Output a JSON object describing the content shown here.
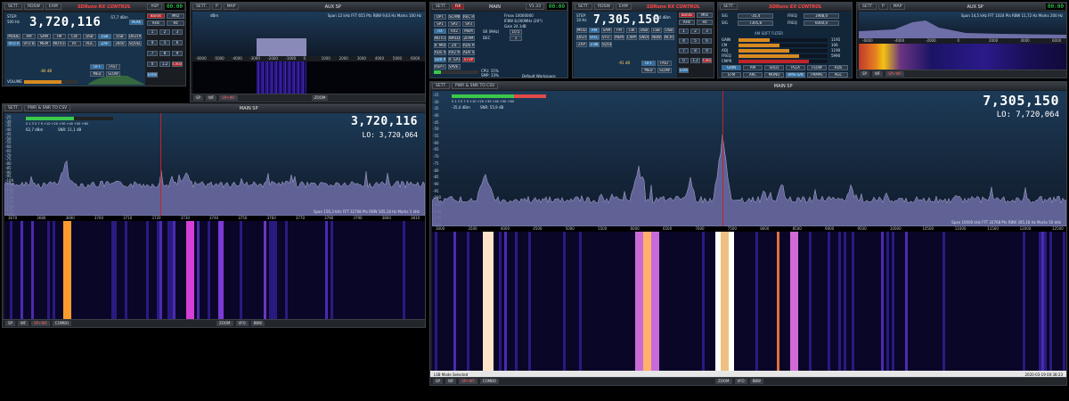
{
  "colors": {
    "accent": "#2c6fa6",
    "marker": "#c0242a",
    "spectrum_fill": "#6e6ea8",
    "segment_green": "#3cff6e"
  },
  "top_left_control": {
    "title": "SDRuno RX CONTROL",
    "clock": "00:00",
    "step_label": "STEP:",
    "step_value": "500 Hz",
    "freq": "3,720,116",
    "dbm": "-57,7 dBm",
    "buttons": [
      "MODE",
      "AM",
      "SAM",
      "FM",
      "CW",
      "DSB",
      "LSB",
      "USB",
      "DIGITAL",
      "VFO A",
      "VFO B",
      "MEM",
      "NOTCH",
      "RF",
      "AGC",
      "ZAP",
      "2850",
      "SQUELCH"
    ],
    "labels": [
      "VFO - CW",
      "FM MODE",
      "NB",
      "NBW",
      "WFM",
      "NFM",
      "MUTE",
      "RX",
      "VOLUME"
    ],
    "squelch_value": "-84 dB",
    "agc_buttons": [
      "OFF",
      "FAST",
      "MED",
      "SLOW"
    ],
    "keypad": [
      "1",
      "2",
      "3",
      "4",
      "5",
      "6",
      "7",
      "8",
      "9",
      "0",
      "1.2",
      "Clear",
      "Enter"
    ],
    "band_buttons": [
      "Bands",
      "Mhz",
      "KHz",
      "Hz"
    ],
    "titlebar_buttons": [
      "SETT.",
      "RDSW",
      "EXM",
      "ASP"
    ],
    "rx_tag": "RX",
    "mode_chip": "PEAK"
  },
  "top_aux_sp": {
    "title": "AUX SP",
    "titlebar_buttons": [
      "SETT.",
      "P",
      "MAP"
    ],
    "dbm_label": "dBm",
    "span_info": "Span 12 kHz  FFT 655 Pts  RBW 9,63 Hz  Marks 100 Hz",
    "ticks": [
      "-6000",
      "-5000",
      "-4000",
      "-3000",
      "-2000",
      "-1000",
      "0",
      "1000",
      "2000",
      "3000",
      "4000",
      "5000",
      "6000"
    ],
    "status_buttons": [
      "SP",
      "WF",
      "SP+WF",
      "ZOOM"
    ]
  },
  "main_window": {
    "title": "MAIN",
    "titlebar_buttons": [
      "SETT.",
      "RX",
      "V1.33"
    ],
    "buttons": [
      "OPT.",
      "SCANNER",
      "REC PANEL",
      "SP1",
      "SP2",
      "SP3",
      "RX",
      "RX2",
      "MEM",
      "NOTCHES",
      "WRLDM",
      "ZFAM",
      "IF MODE",
      "ZIF",
      "RDS PLAY",
      "RDS VRB",
      "RX2 MODE",
      "ADV VRB",
      "SDR PLAY",
      "IF GAIN",
      "STOP",
      "RSP-TT",
      "SAVE WS"
    ],
    "fmax_label": "Fmax",
    "fmax_value": "10000000",
    "ifbw_label": "IFBW",
    "ifbw_value": "8,000MHz (20*)",
    "gain_label": "Gain",
    "gain_value": "24.1dB",
    "sr_label": "SR (MHz)",
    "sr_value": "10.5",
    "dec_label": "DEC",
    "dec_value": "1",
    "cpu_label": "CPU",
    "cpu_value": "CPU: 15%",
    "smp_label": "SMP",
    "smp_value": "SMP: 33%",
    "workspace_label": "Default Workspace",
    "clock": "00:00"
  },
  "mid_control": {
    "title": "SDRuno RX CONTROL",
    "step_label": "STEP:",
    "step_value": "10 Hz",
    "freq": "7,305,150",
    "dbm": "-35,4 dBm",
    "clock": "00:00",
    "titlebar_buttons": [
      "SETT.",
      "RDSW",
      "EXM",
      "AUTO",
      "REYN1",
      "MCTR",
      "TCTR"
    ],
    "buttons": [
      "MODE",
      "AM",
      "SAM",
      "FM",
      "CW",
      "DSB",
      "LSB",
      "USB",
      "DIGITAL",
      "VFO A",
      "VFO B",
      "MEM",
      "CWPW",
      "SNOOP",
      "NBW",
      "NCRS",
      "ZAP",
      "2.8K",
      "SQUELCH"
    ],
    "agc_buttons": [
      "OFF",
      "FAST",
      "MED",
      "SLOW"
    ],
    "keypad": [
      "1",
      "2",
      "3",
      "4",
      "5",
      "6",
      "7",
      "8",
      "9",
      "0",
      "1.2",
      "Clear",
      "Enter"
    ],
    "band_buttons": [
      "Bands",
      "Mhz",
      "KHz",
      "Hz"
    ],
    "squelch_value": "-91 dB",
    "volume_label": "VOLUME"
  },
  "ex_control": {
    "title": "SDRuno EX CONTROL",
    "titlebar_buttons": [
      "SETT.",
      "REYN1",
      "MCTR",
      "TCTR"
    ],
    "rows": [
      {
        "k": "SIG",
        "v": "-35,4"
      },
      {
        "k": "FREQ",
        "v": "1988,0"
      },
      {
        "k": "SIG",
        "v": "7305,8"
      },
      {
        "k": "FREQ",
        "v": "6000,0"
      }
    ],
    "filter_label": "AM SOFT FILTER",
    "buttons": [
      "GAIN",
      "AM",
      "SOLO",
      "PLLA",
      "FLOW",
      "RDS",
      "STM",
      "ARC",
      "MONO",
      "RMS-S/N",
      "PRMPE",
      "AGC"
    ],
    "bars": [
      "GAIN",
      "CM",
      "ADJ",
      "FREQ",
      "CMPR"
    ],
    "values": [
      "1195",
      "106",
      "1190",
      "5990"
    ],
    "noise_label": "NR",
    "noise_value": "0,0"
  },
  "top_right_aux": {
    "title": "AUX SP",
    "clock": "00:00",
    "titlebar_buttons": [
      "SETT.",
      "P",
      "MAP"
    ],
    "span_info": "Span 14,5 kHz  FFT 1024 Pts  RBW 11,72 Hz  Marks 200 Hz",
    "ticks": [
      "-6000",
      "-4000",
      "-2000",
      "0",
      "2000",
      "4000",
      "6000"
    ],
    "status_buttons": [
      "SP",
      "WF",
      "SP+WF"
    ]
  },
  "left_main_sp": {
    "title": "MAIN SP",
    "titlebar_buttons": [
      "SETT.",
      "PWR & SNR TO CSV"
    ],
    "freq": "3,720,116",
    "lo_label": "LO:",
    "lo_value": "3,720,064",
    "dbm": "62,7 dBm",
    "snr": "SNR: 11,1 dB",
    "meter_scale": "S  1  3  5  7  9  +10  +20  +30  +40  +50  +60",
    "y_ticks": [
      "-25",
      "-30",
      "-35",
      "-40",
      "-45",
      "-50",
      "-55",
      "-60",
      "-65",
      "-70",
      "-75",
      "-80",
      "-85",
      "-90",
      "-95",
      "-100",
      "-105",
      "-110",
      "-115",
      "-120",
      "-125",
      "-130",
      "-135",
      "-140"
    ],
    "x_ticks": [
      "3670",
      "3680",
      "3690",
      "3700",
      "3710",
      "3720",
      "3730",
      "3740",
      "3750",
      "3760",
      "3770",
      "3780",
      "3790",
      "3800",
      "3810"
    ],
    "span_info": "Span 156,3 kHz  FFT 32768 Pts  RBW 305,18 Hz  Marks 1 kHz",
    "status_buttons": [
      "SP",
      "WF",
      "SP+WF",
      "COMBO",
      "ZOOM",
      "VFO",
      "BBW"
    ]
  },
  "right_main_sp": {
    "title": "MAIN SP",
    "titlebar_buttons": [
      "SETT.",
      "PWR & SNR TO CSV"
    ],
    "freq": "7,305,150",
    "lo_label": "LO:",
    "lo_value": "7,720,064",
    "dbm": "-35,4 dBm",
    "snr": "SNR: 55,9 dB",
    "meter_scale": "S  1  3  5  7  9  +10  +20  +30  +40  +50  +60",
    "y_ticks": [
      "-25",
      "-30",
      "-35",
      "-40",
      "-45",
      "-50",
      "-55",
      "-60",
      "-65",
      "-70",
      "-75",
      "-80",
      "-85",
      "-90",
      "-95",
      "-100",
      "-105",
      "-110",
      "-115",
      "-120"
    ],
    "x_ticks": [
      "3000",
      "3500",
      "4000",
      "4500",
      "5000",
      "5500",
      "6000",
      "6500",
      "7000",
      "7500",
      "8000",
      "8500",
      "9000",
      "9500",
      "10000",
      "10500",
      "11000",
      "11500",
      "12000",
      "12500"
    ],
    "span_info": "Span 10000 kHz  FFT 32768 Pts  RBW 305,18 Hz  Marks 50 kHz",
    "status_buttons": [
      "SP",
      "WF",
      "SP+WF",
      "COMBO",
      "ZOOM",
      "VFO",
      "BBW"
    ],
    "status_text": "LSB Mode Selected",
    "timestamp": "2020-03-19 00:38:23"
  }
}
